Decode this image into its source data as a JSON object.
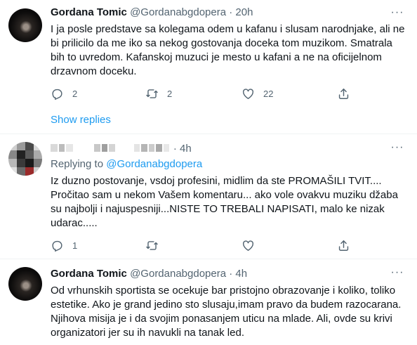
{
  "tweets": [
    {
      "name": "Gordana Tomic",
      "handle": "@Gordanabgdopera",
      "separator": "·",
      "time": "20h",
      "more": "···",
      "text": "I ja posle predstave sa kolegama odem u kafanu i slusam narodnjake, ali ne bi prilicilo da me iko sa nekog gostovanja doceka tom muzikom. Smatrala bih to uvredom. Kafanskoj muzuci je mesto u kafani a ne na oficijelnom drzavnom doceku.",
      "reply_count": "2",
      "retweet_count": "2",
      "like_count": "22",
      "show_replies": "Show replies"
    },
    {
      "name": "",
      "handle": "",
      "separator": "·",
      "time": "4h",
      "more": "···",
      "replying_prefix": "Replying to",
      "replying_to": "@Gordanabgdopera",
      "text": "Iz duzno postovanje, vsdoj profesini, midlim da ste PROMAŠILI  TVIT....\nPročitao sam u nekom Vašem komentaru... ako vole ovakvu muziku džaba su najbolji i najuspesniji...NISTE TO TREBALI NAPISATI, malo ke nizak udarac.....",
      "reply_count": "1",
      "retweet_count": "",
      "like_count": ""
    },
    {
      "name": "Gordana Tomic",
      "handle": "@Gordanabgdopera",
      "separator": "·",
      "time": "4h",
      "more": "···",
      "text": "Od vrhunskih sportista se ocekuje bar pristojno obrazovanje i koliko, toliko estetike. Ako je grand jedino sto slusaju,imam pravo da budem razocarana. Njihova misija je i da svojim ponasanjem uticu na mlade. Ali, ovde su krivi organizatori jer su ih navukli na tanak led."
    }
  ],
  "colors": {
    "accent": "#1d9bf0",
    "muted": "#536471",
    "text": "#0f1419",
    "divider": "#eff3f4"
  },
  "icons": [
    "reply-icon",
    "retweet-icon",
    "like-icon",
    "share-icon",
    "more-icon"
  ]
}
